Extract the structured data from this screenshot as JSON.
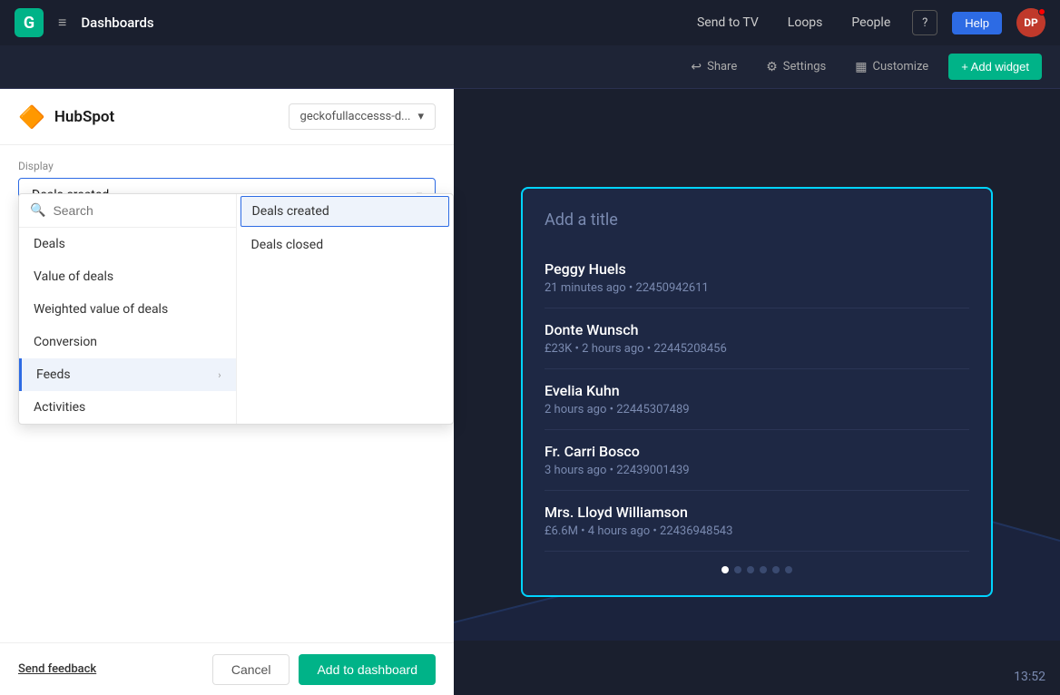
{
  "nav": {
    "logo_text": "G",
    "hamburger": "≡",
    "title": "Dashboards",
    "send_to_tv": "Send to TV",
    "loops": "Loops",
    "people": "People",
    "help_icon": "?",
    "help_label": "Help",
    "avatar_initials": "DP"
  },
  "toolbar": {
    "share_label": "Share",
    "settings_label": "Settings",
    "customize_label": "Customize",
    "add_widget_label": "+ Add widget"
  },
  "left_panel": {
    "brand_icon": "🔶",
    "brand_name": "HubSpot",
    "account_dropdown": "geckofullaccesss-d...",
    "display_label": "Display",
    "selected_display": "Deals created",
    "search_placeholder": "Search",
    "menu_items": [
      {
        "id": "deals",
        "label": "Deals",
        "has_submenu": false,
        "active": false
      },
      {
        "id": "value_of_deals",
        "label": "Value of deals",
        "has_submenu": false,
        "active": false
      },
      {
        "id": "weighted_value_of_deals",
        "label": "Weighted value of deals",
        "has_submenu": false,
        "active": false
      },
      {
        "id": "conversion",
        "label": "Conversion",
        "has_submenu": false,
        "active": false
      },
      {
        "id": "feeds",
        "label": "Feeds",
        "has_submenu": true,
        "active": true
      },
      {
        "id": "activities",
        "label": "Activities",
        "has_submenu": false,
        "active": false
      }
    ],
    "submenu_items": [
      {
        "id": "deals_created",
        "label": "Deals created",
        "selected": true
      },
      {
        "id": "deals_closed",
        "label": "Deals closed",
        "selected": false
      }
    ]
  },
  "widget": {
    "title": "Add a title",
    "items": [
      {
        "name": "Peggy Huels",
        "meta": "21 minutes ago • 22450942611"
      },
      {
        "name": "Donte Wunsch",
        "meta": "£23K • 2 hours ago • 22445208456"
      },
      {
        "name": "Evelia Kuhn",
        "meta": "2 hours ago • 22445307489"
      },
      {
        "name": "Fr. Carri Bosco",
        "meta": "3 hours ago • 22439001439"
      },
      {
        "name": "Mrs. Lloyd Williamson",
        "meta": "£6.6M • 4 hours ago • 22436948543"
      }
    ],
    "dots": [
      true,
      false,
      false,
      false,
      false,
      false
    ],
    "clock": "13:52"
  },
  "bottom_bar": {
    "send_feedback": "Send feedback",
    "cancel": "Cancel",
    "add_to_dashboard": "Add to dashboard"
  }
}
